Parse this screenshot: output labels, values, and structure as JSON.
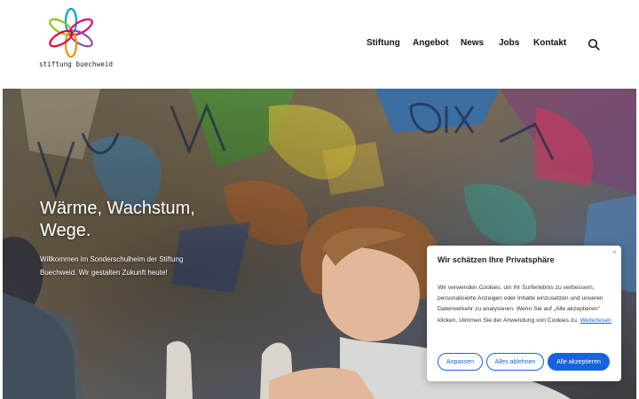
{
  "brand": {
    "name": "stiftung buechweid",
    "logo_petal_colors": [
      "#e4003a",
      "#f39200",
      "#95c11f",
      "#009fe3",
      "#8e4f9d",
      "#e6007e"
    ]
  },
  "nav": {
    "items": [
      "Stiftung",
      "Angebot",
      "News",
      "Jobs",
      "Kontakt"
    ],
    "search_icon": "search-icon"
  },
  "hero": {
    "title": "Wärme, Wachstum, Wege.",
    "subtitle": "Willkommen im Sonderschulheim der Stiftung Buechweid. Wir gestalten Zukunft heute!",
    "background": "graffiti-wall-with-boy-sculpting"
  },
  "cookie": {
    "title": "Wir schätzen Ihre Privatsphäre",
    "text": "Wir verwenden Cookies, um Ihr Surferlebnis zu verbessern, personalisierte Anzeigen oder Inhalte einzusetzen und unseren Datenverkehr zu analysieren. Wenn Sie auf „Alle akzeptieren\" klicken, stimmen Sie der Anwendung von Cookies zu.",
    "link": "Weiterlesen",
    "close": "×",
    "buttons": {
      "customize": "Anpassen",
      "reject": "Alles ablehnen",
      "accept": "Alle akzeptieren"
    },
    "accent": "#1863dc"
  }
}
